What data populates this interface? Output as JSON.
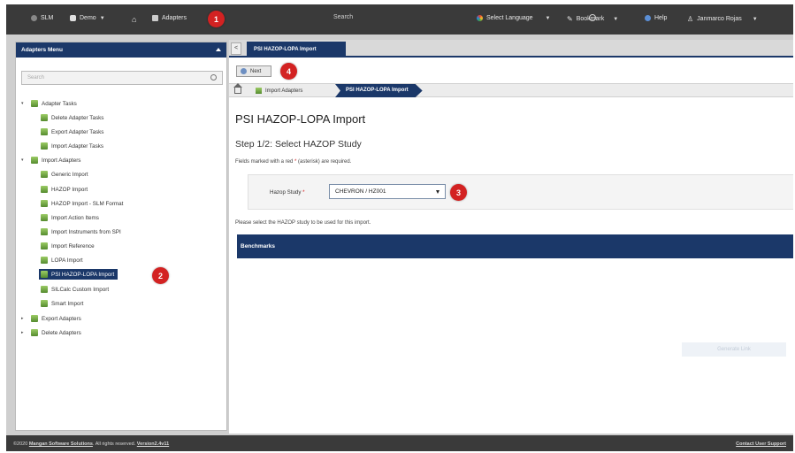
{
  "topbar": {
    "app": "SLM",
    "site": "Demo",
    "adapters": "Adapters",
    "search_placeholder": "Search",
    "language": "Select Language",
    "bookmark": "Bookmark",
    "help": "Help",
    "user": "Janmarco Rojas"
  },
  "annotations": {
    "b1": "1",
    "b2": "2",
    "b3": "3",
    "b4": "4"
  },
  "sidebar": {
    "title": "Adapters Menu",
    "search_placeholder": "Search",
    "items": [
      {
        "label": "Adapter Tasks",
        "toggle": "▾"
      },
      {
        "label": "Delete Adapter Tasks"
      },
      {
        "label": "Export Adapter Tasks"
      },
      {
        "label": "Import Adapter Tasks"
      },
      {
        "label": "Import Adapters",
        "toggle": "▾"
      },
      {
        "label": "Generic Import"
      },
      {
        "label": "HAZOP Import"
      },
      {
        "label": "HAZOP Import - SLM Format"
      },
      {
        "label": "Import Action Items"
      },
      {
        "label": "Import Instruments from SPI"
      },
      {
        "label": "Import Reference"
      },
      {
        "label": "LOPA Import"
      },
      {
        "label": "PSI HAZOP-LOPA Import"
      },
      {
        "label": "SILCalc Custom Import"
      },
      {
        "label": "Smart Import"
      },
      {
        "label": "Export Adapters",
        "toggle": "▸"
      },
      {
        "label": "Delete Adapters",
        "toggle": "▸"
      }
    ]
  },
  "main": {
    "back_glyph": "<",
    "tab": "PSI HAZOP-LOPA Import",
    "next_label": "Next",
    "breadcrumb": {
      "parent": "Import Adapters",
      "current": "PSI HAZOP-LOPA Import"
    },
    "page_title": "PSI HAZOP-LOPA Import",
    "step_title": "Step 1/2: Select HAZOP Study",
    "required_note_pre": "Fields marked with a red ",
    "required_star": "*",
    "required_note_post": " (asterisk) are required.",
    "field_label": "Hazop Study",
    "field_value": "CHEVRON / HZ001",
    "help_note": "Please select the HAZOP study to be used for this import.",
    "section_header": "Benchmarks",
    "ghost_button": "Generate Link"
  },
  "footer": {
    "copyright_pre": "©2020 ",
    "company": "Mangan Software Solutions",
    "copyright_post": ". All rights reserved. ",
    "version": "Version2.4v11",
    "contact": "Contact User Support"
  },
  "colors": {
    "navy": "#1b3869",
    "dark": "#3a3a3a",
    "badge": "#d32222"
  }
}
